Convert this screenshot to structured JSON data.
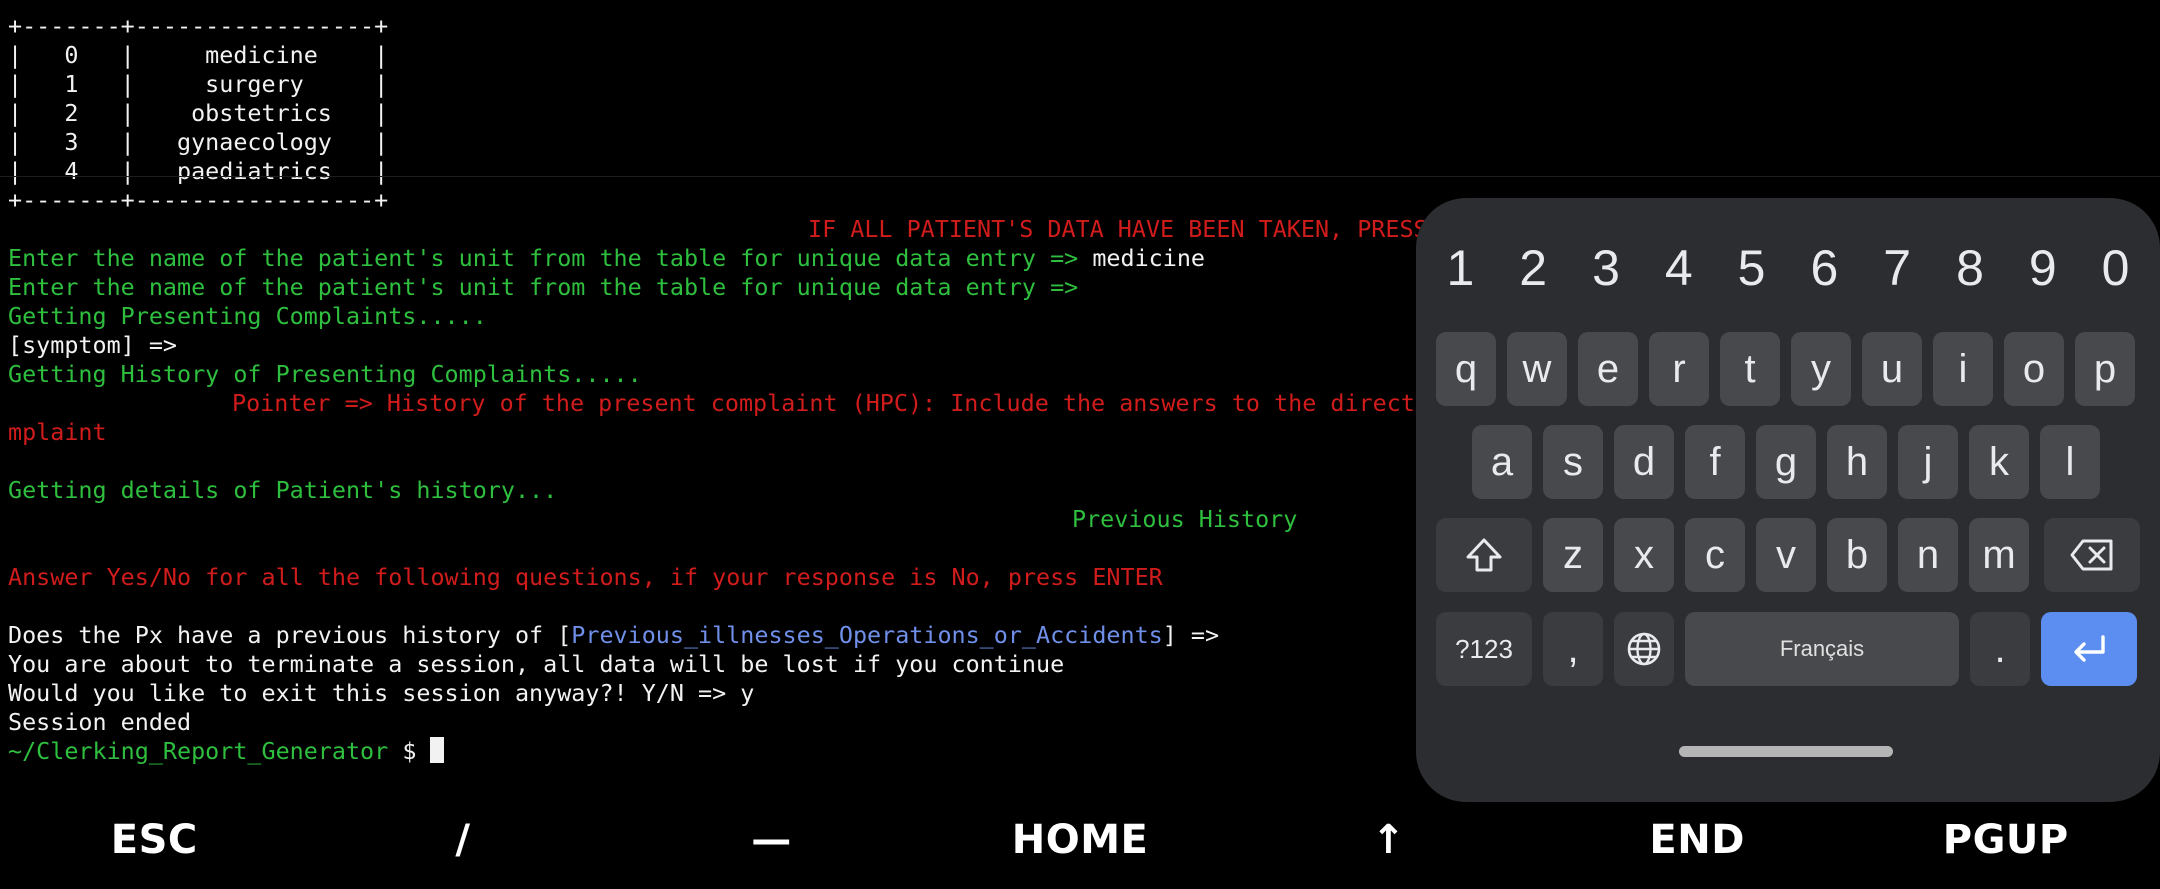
{
  "terminal": {
    "table": {
      "border": "+-------+-----------------+",
      "rows": [
        "|   0   |     medicine    |",
        "|   1   |     surgery     |",
        "|   2   |    obstetrics   |",
        "|   3   |   gynaecology   |",
        "|   4   |   paediatrics   |"
      ]
    },
    "banner": "IF ALL PATIENT'S DATA HAVE BEEN TAKEN, PRESS",
    "entry_prompt": "Enter the name of the patient's unit from the table for unique data entry => ",
    "entry_value": "medicine",
    "entry_prompt_2": "Enter the name of the patient's unit from the table for unique data entry =>",
    "presenting": "Getting Presenting Complaints.....",
    "symptom_prompt": "[symptom] =>",
    "hpc_heading": "Getting History of Presenting Complaints.....",
    "pointer": "Pointer => History of the present complaint (HPC): Include the answers to the direct",
    "pointer_cont": "mplaint",
    "history_heading": "Getting details of Patient's history...",
    "previous_history": "Previous History",
    "answer_hint": "Answer Yes/No for all the following questions, if your response is No, press ENTER",
    "question_prefix": "Does the Px have a previous history of [",
    "question_topic": "Previous_illnesses_Operations_or_Accidents",
    "question_suffix": "] =>",
    "warning": "You are about to terminate a session, all data will be lost if you continue",
    "exit_prompt": "Would you like to exit this session anyway?! Y/N => y",
    "ended": "Session ended",
    "prompt_path": "~/Clerking_Report_Generator",
    "prompt_symbol": " $ "
  },
  "extra_keys": [
    "ESC",
    "/",
    "—",
    "HOME",
    "↑",
    "END",
    "PGUP"
  ],
  "keyboard": {
    "numbers": [
      "1",
      "2",
      "3",
      "4",
      "5",
      "6",
      "7",
      "8",
      "9",
      "0"
    ],
    "row1": [
      "q",
      "w",
      "e",
      "r",
      "t",
      "y",
      "u",
      "i",
      "o",
      "p"
    ],
    "row2": [
      "a",
      "s",
      "d",
      "f",
      "g",
      "h",
      "j",
      "k",
      "l"
    ],
    "row3": [
      "z",
      "x",
      "c",
      "v",
      "b",
      "n",
      "m"
    ],
    "symbols_label": "?123",
    "comma": ",",
    "space_label": "Français",
    "period": "."
  },
  "colors": {
    "green": "#2fbf3f",
    "red": "#d11c1c",
    "blue": "#6f8fe8",
    "keyboard_bg": "#2b2d30",
    "key_bg": "#47494c",
    "enter_bg": "#5b8ef0"
  }
}
